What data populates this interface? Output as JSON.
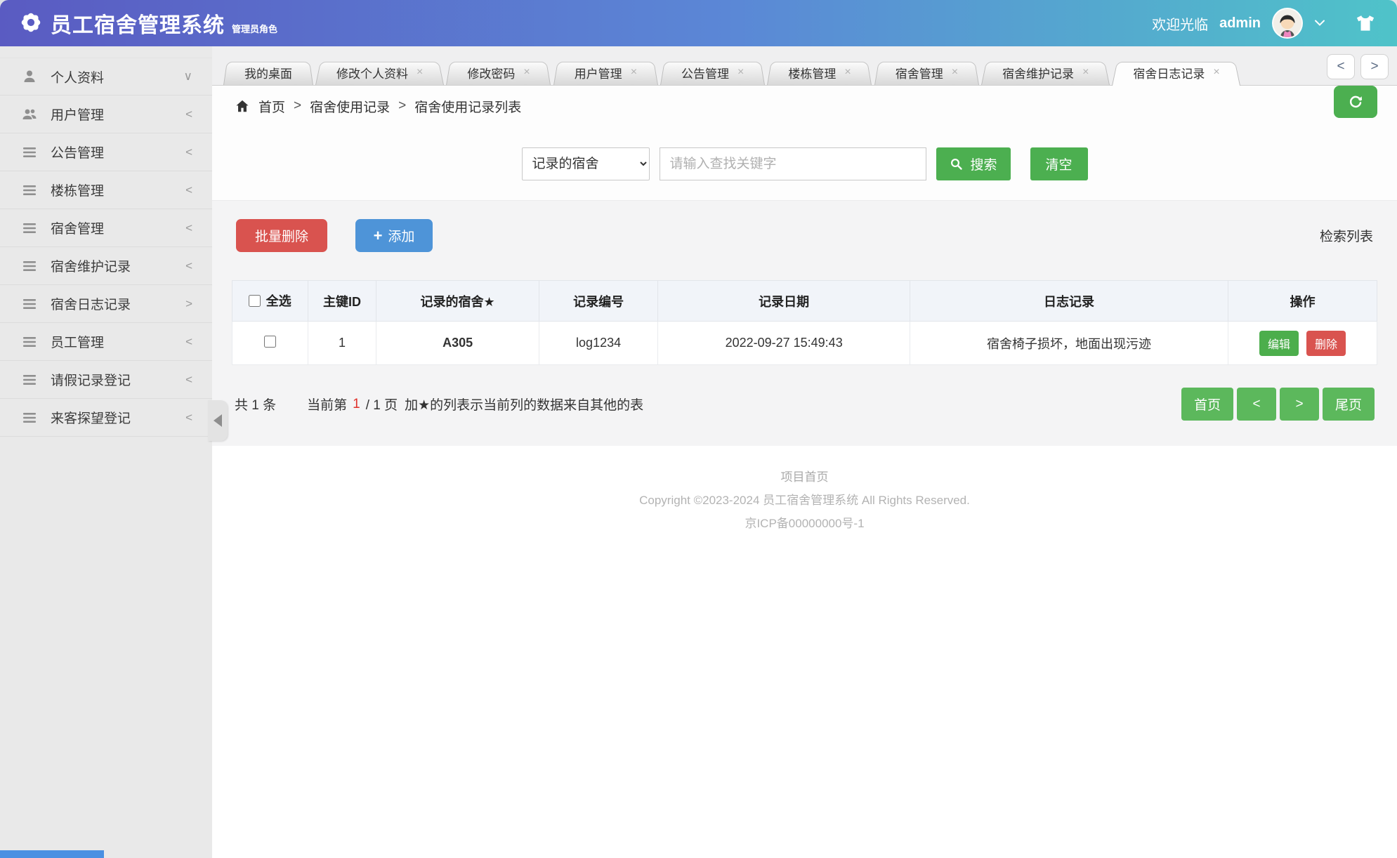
{
  "header": {
    "title": "员工宿舍管理系统",
    "subtitle": "管理员角色",
    "welcome": "欢迎光临",
    "username": "admin"
  },
  "sidebar": {
    "items": [
      {
        "label": "个人资料",
        "icon": "user-icon",
        "chevron": "∨"
      },
      {
        "label": "用户管理",
        "icon": "users-icon",
        "chevron": "<"
      },
      {
        "label": "公告管理",
        "icon": "list-icon",
        "chevron": "<"
      },
      {
        "label": "楼栋管理",
        "icon": "list-icon",
        "chevron": "<"
      },
      {
        "label": "宿舍管理",
        "icon": "list-icon",
        "chevron": "<"
      },
      {
        "label": "宿舍维护记录",
        "icon": "list-icon",
        "chevron": "<"
      },
      {
        "label": "宿舍日志记录",
        "icon": "list-icon",
        "chevron": ">"
      },
      {
        "label": "员工管理",
        "icon": "list-icon",
        "chevron": "<"
      },
      {
        "label": "请假记录登记",
        "icon": "list-icon",
        "chevron": "<"
      },
      {
        "label": "来客探望登记",
        "icon": "list-icon",
        "chevron": "<"
      }
    ]
  },
  "tabs": {
    "close_glyph": "×",
    "prev": "<",
    "next": ">",
    "items": [
      {
        "label": "我的桌面"
      },
      {
        "label": "修改个人资料"
      },
      {
        "label": "修改密码"
      },
      {
        "label": "用户管理"
      },
      {
        "label": "公告管理"
      },
      {
        "label": "楼栋管理"
      },
      {
        "label": "宿舍管理"
      },
      {
        "label": "宿舍维护记录"
      },
      {
        "label": "宿舍日志记录"
      }
    ]
  },
  "breadcrumb": {
    "separator": ">",
    "items": [
      "首页",
      "宿舍使用记录",
      "宿舍使用记录列表"
    ]
  },
  "search": {
    "filter_value": "记录的宿舍",
    "placeholder": "请输入查找关键字",
    "search_label": "搜索",
    "clear_label": "清空"
  },
  "toolbar": {
    "batch_delete_label": "批量删除",
    "add_plus": "+",
    "add_label": "添加",
    "panel_title": "检索列表"
  },
  "table": {
    "headers": {
      "select_all": "全选",
      "id": "主键ID",
      "dorm": "记录的宿舍★",
      "code": "记录编号",
      "date": "记录日期",
      "log": "日志记录",
      "ops": "操作"
    },
    "row": {
      "id": "1",
      "dorm": "A305",
      "code": "log1234",
      "date": "2022-09-27 15:49:43",
      "log": "宿舍椅子损坏，地面出现污迹"
    },
    "edit_label": "编辑",
    "delete_label": "删除"
  },
  "pagination": {
    "total": "共 1 条",
    "current_prefix": "当前第",
    "current_page": "1",
    "current_suffix": "/ 1 页",
    "star_note": "加★的列表示当前列的数据来自其他的表",
    "first": "首页",
    "prev": "<",
    "next": ">",
    "last": "尾页"
  },
  "footer": {
    "line1": "项目首页",
    "line2": "Copyright ©2023-2024 员工宿舍管理系统 All Rights Reserved.",
    "line3": "京ICP备00000000号-1"
  },
  "colors": {
    "accent_green": "#4caf50",
    "danger_red": "#d9534f",
    "primary_blue": "#4e94d8",
    "highlight_red": "#b22228",
    "header_gradient": [
      "#5a5bc2",
      "#5b87d6",
      "#4fc3c9"
    ]
  }
}
